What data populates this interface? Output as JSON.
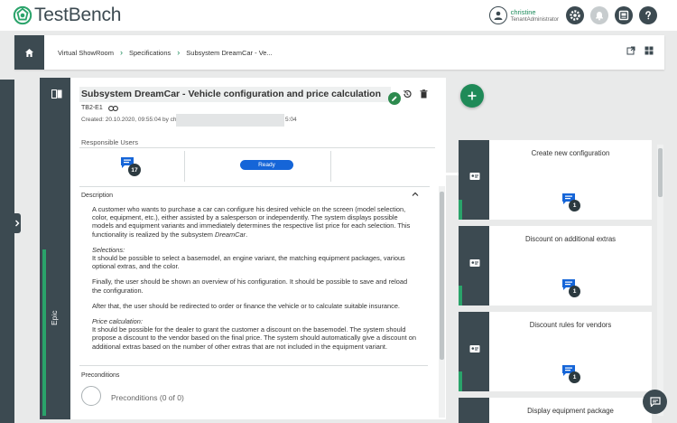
{
  "app": {
    "name": "TestBench"
  },
  "user": {
    "name": "christine",
    "role": "TenantAdministrator"
  },
  "header_icons": [
    "settings-icon",
    "notification-bell-icon",
    "media-icon",
    "help-icon"
  ],
  "breadcrumb": {
    "items": [
      "Virtual ShowRoom",
      "Specifications",
      "Subsystem DreamCar - Ve..."
    ],
    "separator": ">"
  },
  "epic": {
    "type_label": "Epic",
    "title": "Subsystem DreamCar - Vehicle configuration and price calculation",
    "key": "TB2-E1",
    "created_prefix": "Created: 20.10.2020, 09:55:04 by ch",
    "created_suffix": "5:04",
    "responsible_users_label": "Responsible Users",
    "comment_count": "17",
    "status": "Ready",
    "description_label": "Description",
    "description": {
      "p1": "A customer who wants to purchase a car can configure his desired vehicle on the screen (model selection, color, equipment, etc.), either assisted by a salesperson or independently. The system displays possible models and equipment variants and immediately determines the respective list price for each selection. This functionality is realized by the subsystem ",
      "p1_italic": "DreamCar",
      "p1_end": ".",
      "h_selections": "Selections:",
      "p2": "It should be possible to select a basemodel, an engine variant, the matching equipment packages, various optional extras, and the color.",
      "p3": "Finally, the user should be shown an overview of his configuration. It should be possible to save and reload the configuration.",
      "p4": "After that, the user should be redirected to order or finance the vehicle or to calculate suitable insurance.",
      "h_price": "Price calculation:",
      "p5": "It should be possible for the dealer to grant the customer a discount on the basemodel. The system should propose a discount to the vendor based on the final price. The system should automatically give a discount on additional extras based on the number of other extras that are not included in the equipment variant."
    },
    "preconditions_label": "Preconditions",
    "preconditions_text": "Preconditions (0 of 0)"
  },
  "stories": [
    {
      "title": "Create new configuration",
      "comments": "1"
    },
    {
      "title": "Discount on additional extras",
      "comments": "1"
    },
    {
      "title": "Discount rules for vendors",
      "comments": "1"
    },
    {
      "title": "Display equipment package",
      "comments": ""
    }
  ],
  "colors": {
    "dark": "#3c4a51",
    "accent_green": "#1f8a58",
    "status_blue": "#1565d8"
  }
}
